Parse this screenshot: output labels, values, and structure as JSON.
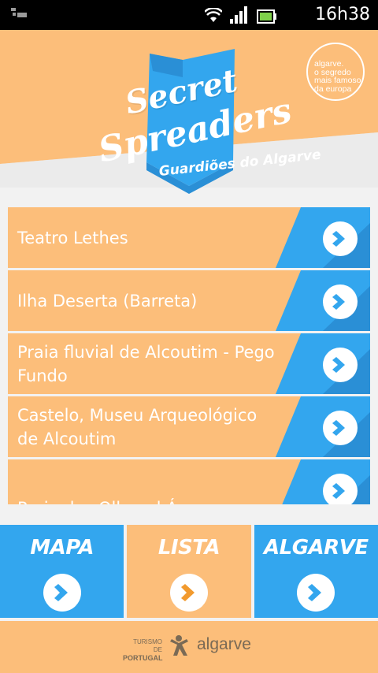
{
  "status_bar": {
    "time": "16h38"
  },
  "logo": {
    "title_line1": "Secret",
    "title_line2": "Spreaders",
    "subtitle": "Guardiões do Algarve",
    "seal_lines": [
      "algarve.",
      "o segredo",
      "mais famoso",
      "da europa"
    ]
  },
  "places": [
    {
      "label": "Teatro Lethes"
    },
    {
      "label": "Ilha Deserta (Barreta)"
    },
    {
      "label": "Praia fluvial de Alcoutim - Pego Fundo"
    },
    {
      "label": "Castelo, Museu Arqueológico de Alcoutim"
    },
    {
      "label": "Praia dos Olhos d Água"
    }
  ],
  "nav": {
    "tabs": [
      {
        "label": "MAPA",
        "active": false
      },
      {
        "label": "LISTA",
        "active": true
      },
      {
        "label": "ALGARVE",
        "active": false
      }
    ]
  },
  "footer": {
    "turismo_line1": "TURISMO DE",
    "turismo_line2": "PORTUGAL",
    "brand": "algarve"
  },
  "colors": {
    "orange": "#fcbe7a",
    "blue": "#33a6ee",
    "blue_dark": "#2a8fd6",
    "arrow_orange": "#f29a2e"
  }
}
